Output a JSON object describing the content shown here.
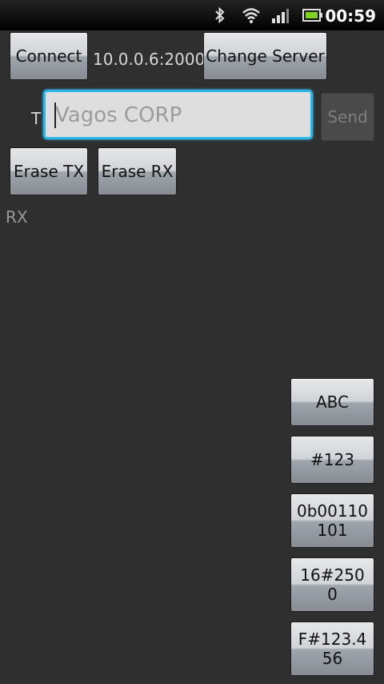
{
  "status_bar": {
    "time": "00:59",
    "icons": [
      "bluetooth-icon",
      "wifi-icon",
      "signal-icon",
      "battery-icon"
    ]
  },
  "connection": {
    "connect_label": "Connect",
    "server_address": "10.0.0.6:2000",
    "change_server_label": "Change Server"
  },
  "tx": {
    "label": "T",
    "placeholder": "Vagos CORP",
    "send_label": "Send"
  },
  "erase": {
    "erase_tx_label": "Erase TX",
    "erase_rx_label": "Erase RX"
  },
  "rx": {
    "label": "RX"
  },
  "format_buttons": [
    {
      "label": "ABC"
    },
    {
      "label": "#123"
    },
    {
      "label": "0b00110\n101"
    },
    {
      "label": "16#250\n0"
    },
    {
      "label": "F#123.4\n56"
    }
  ],
  "colors": {
    "background": "#2f2f2f",
    "accent": "#2fb6e8"
  }
}
